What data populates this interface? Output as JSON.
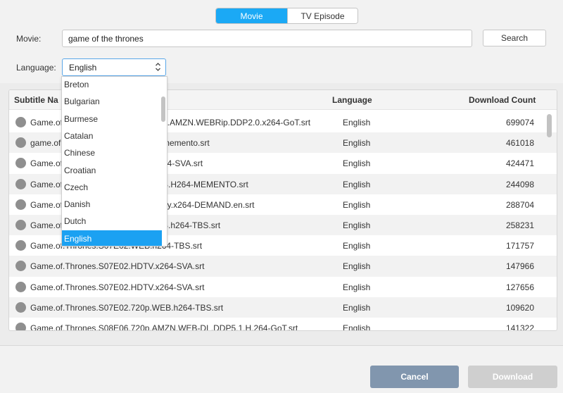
{
  "mode_tabs": [
    {
      "label": "Movie",
      "active": true
    },
    {
      "label": "TV Episode",
      "active": false
    }
  ],
  "search": {
    "movie_label": "Movie:",
    "movie_value": "game of the thrones",
    "search_button": "Search",
    "language_label": "Language:",
    "language_value": "English"
  },
  "table": {
    "headers": {
      "name": "Subtitle Na",
      "language": "Language",
      "count": "Download Count"
    },
    "rows": [
      {
        "name": "Game.of.Thrones.S07E02.1080p.AMZN.WEBRip.DDP2.0.x264-GoT.srt",
        "visible_name": "Game.of",
        "tail": "n.AMZN.WEBRip.DDP2.0.x264-GoT.srt",
        "language": "English",
        "count": "699074"
      },
      {
        "name": "game.of",
        "visible_name": "game.of",
        "tail": "memento.srt",
        "language": "English",
        "count": "461018"
      },
      {
        "name": "Game.of",
        "visible_name": "Game.of",
        "tail": "64-SVA.srt",
        "language": "English",
        "count": "424471"
      },
      {
        "name": "Game.of",
        "visible_name": "Game.of",
        "tail": "B.H264-MEMENTO.srt",
        "language": "English",
        "count": "244098"
      },
      {
        "name": "Game.of",
        "visible_name": "Game.of",
        "tail": "ay.x264-DEMAND.en.srt",
        "language": "English",
        "count": "288704"
      },
      {
        "name": "Game.of",
        "visible_name": "Game.of",
        "tail": "B.h264-TBS.srt",
        "language": "English",
        "count": "258231"
      },
      {
        "name": "Game.of.Thrones.S07E02.WEB.h264-TBS.srt",
        "visible_name": "Game.of.Thrones.S07E02.WEB.h264-TBS.srt",
        "tail": "",
        "language": "English",
        "count": "171757"
      },
      {
        "name": "Game.of.Thrones.S07E02.HDTV.x264-SVA.srt",
        "visible_name": "Game.of.Thrones.S07E02.HDTV.x264-SVA.srt",
        "tail": "",
        "language": "English",
        "count": "147966"
      },
      {
        "name": "Game.of.Thrones.S07E02.HDTV.x264-SVA.srt",
        "visible_name": "Game.of.Thrones.S07E02.HDTV.x264-SVA.srt",
        "tail": "",
        "language": "English",
        "count": "127656"
      },
      {
        "name": "Game.of.Thrones.S07E02.720p.WEB.h264-TBS.srt",
        "visible_name": "Game.of.Thrones.S07E02.720p.WEB.h264-TBS.srt",
        "tail": "",
        "language": "English",
        "count": "109620"
      },
      {
        "name": "Game.of.Thrones.S08E06.720p.AMZN.WEB-DL.DDP5.1.H.264-GoT.srt",
        "visible_name": "Game.of.Thrones.S08E06.720p.AMZN.WEB-DL.DDP5.1.H.264-GoT.srt",
        "tail": "",
        "language": "English",
        "count": "141322"
      }
    ]
  },
  "language_dropdown": {
    "options": [
      "Breton",
      "Bulgarian",
      "Burmese",
      "Catalan",
      "Chinese",
      "Croatian",
      "Czech",
      "Danish",
      "Dutch",
      "English"
    ],
    "selected": "English"
  },
  "footer": {
    "cancel": "Cancel",
    "download": "Download"
  },
  "colors": {
    "accent": "#1ba9f5",
    "cancel_bg": "#8196ae",
    "download_disabled": "#cfcfcf"
  }
}
